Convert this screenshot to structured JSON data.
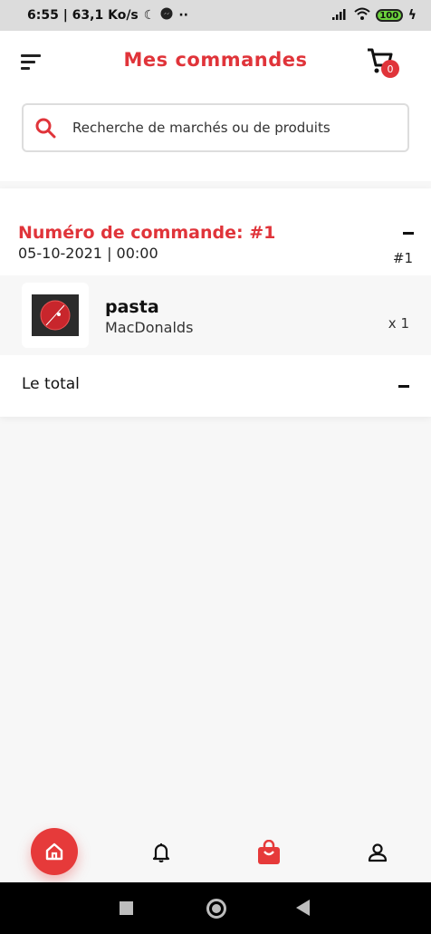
{
  "status_bar": {
    "time_speed": "6:55 | 63,1 Ko/s",
    "battery": "100"
  },
  "app_bar": {
    "title": "Mes commandes",
    "cart_count": "0"
  },
  "search": {
    "placeholder": "Recherche de marchés ou de produits"
  },
  "order": {
    "number_label": "Numéro de commande: #1",
    "date": "05-10-2021 | 00:00",
    "id_tag": "#1",
    "items": [
      {
        "name": "pasta",
        "vendor": "MacDonalds",
        "quantity": "x 1"
      }
    ],
    "total_label": "Le total"
  },
  "colors": {
    "accent": "#e0343a"
  },
  "icons": {
    "menu": "menu-icon",
    "cart": "cart-icon",
    "search": "search-icon",
    "home": "home-icon",
    "notifications": "bell-icon",
    "orders": "shopping-bag-icon",
    "profile": "person-icon"
  }
}
